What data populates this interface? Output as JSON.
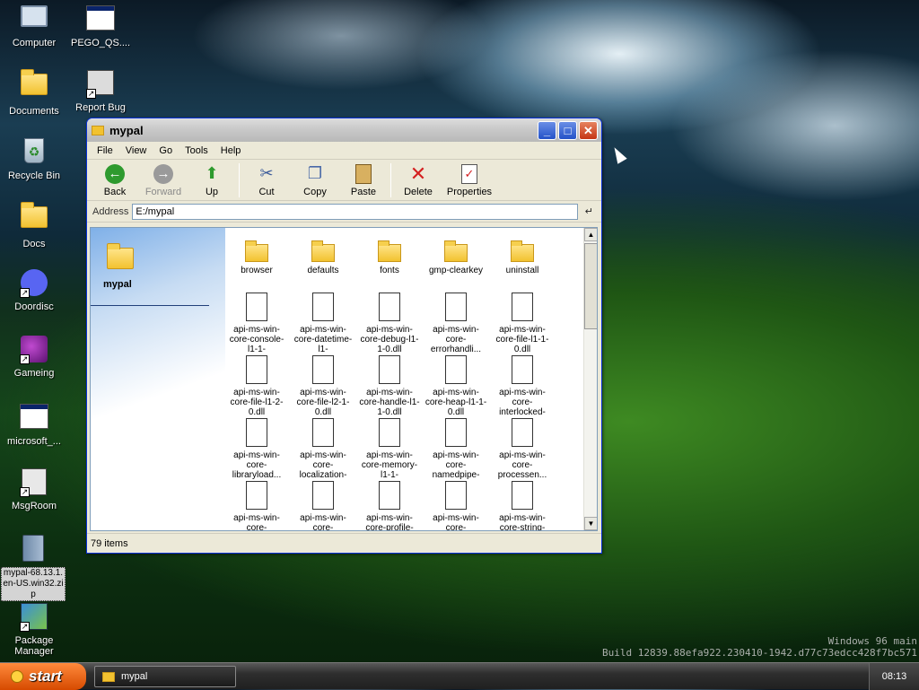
{
  "desktop_icons": [
    {
      "label": "Computer",
      "icon": "computer-icon"
    },
    {
      "label": "PEGO_QS....",
      "icon": "window-icon"
    },
    {
      "label": "Documents",
      "icon": "folder-icon"
    },
    {
      "label": "Report Bug",
      "icon": "report-icon"
    },
    {
      "label": "Recycle Bin",
      "icon": "recycle-bin-icon"
    },
    {
      "label": "Docs",
      "icon": "folder-icon"
    },
    {
      "label": "Doordisc",
      "icon": "discord-icon"
    },
    {
      "label": "Gameing",
      "icon": "cube-icon"
    },
    {
      "label": "microsoft_...",
      "icon": "window-icon"
    },
    {
      "label": "MsgRoom",
      "icon": "msgroom-icon"
    },
    {
      "label": "mypal-68.13.1.en-US.win32.zip",
      "icon": "zip-icon"
    },
    {
      "label": "Package Manager",
      "icon": "package-icon"
    }
  ],
  "window": {
    "title": "mypal",
    "menu": [
      "File",
      "View",
      "Go",
      "Tools",
      "Help"
    ],
    "toolbar": {
      "back": "Back",
      "forward": "Forward",
      "up": "Up",
      "cut": "Cut",
      "copy": "Copy",
      "paste": "Paste",
      "delete": "Delete",
      "properties": "Properties"
    },
    "address_label": "Address",
    "address_value": "E:/mypal",
    "left_panel_title": "mypal",
    "files": [
      {
        "name": "browser",
        "type": "folder"
      },
      {
        "name": "defaults",
        "type": "folder"
      },
      {
        "name": "fonts",
        "type": "folder"
      },
      {
        "name": "gmp-clearkey",
        "type": "folder"
      },
      {
        "name": "uninstall",
        "type": "folder"
      },
      {
        "name": "api-ms-win-core-console-l1-1-",
        "type": "file"
      },
      {
        "name": "api-ms-win-core-datetime-l1-",
        "type": "file"
      },
      {
        "name": "api-ms-win-core-debug-l1-1-0.dll",
        "type": "file"
      },
      {
        "name": "api-ms-win-core-errorhandli...",
        "type": "file"
      },
      {
        "name": "api-ms-win-core-file-l1-1-0.dll",
        "type": "file"
      },
      {
        "name": "api-ms-win-core-file-l1-2-0.dll",
        "type": "file"
      },
      {
        "name": "api-ms-win-core-file-l2-1-0.dll",
        "type": "file"
      },
      {
        "name": "api-ms-win-core-handle-l1-1-0.dll",
        "type": "file"
      },
      {
        "name": "api-ms-win-core-heap-l1-1-0.dll",
        "type": "file"
      },
      {
        "name": "api-ms-win-core-interlocked-",
        "type": "file"
      },
      {
        "name": "api-ms-win-core-libraryload...",
        "type": "file"
      },
      {
        "name": "api-ms-win-core-localization-",
        "type": "file"
      },
      {
        "name": "api-ms-win-core-memory-l1-1-",
        "type": "file"
      },
      {
        "name": "api-ms-win-core-namedpipe-",
        "type": "file"
      },
      {
        "name": "api-ms-win-core-processen...",
        "type": "file"
      },
      {
        "name": "api-ms-win-core-",
        "type": "file"
      },
      {
        "name": "api-ms-win-core-",
        "type": "file"
      },
      {
        "name": "api-ms-win-core-profile-",
        "type": "file"
      },
      {
        "name": "api-ms-win-core-",
        "type": "file"
      },
      {
        "name": "api-ms-win-core-string-",
        "type": "file"
      }
    ],
    "status": "79 items"
  },
  "taskbar": {
    "start_label": "start",
    "task_label": "mypal",
    "clock": "08:13"
  },
  "watermark": {
    "line1": "Windows 96 main",
    "line2": "Build 12839.88efa922.230410-1942.d77c73edcc428f7bc571"
  }
}
